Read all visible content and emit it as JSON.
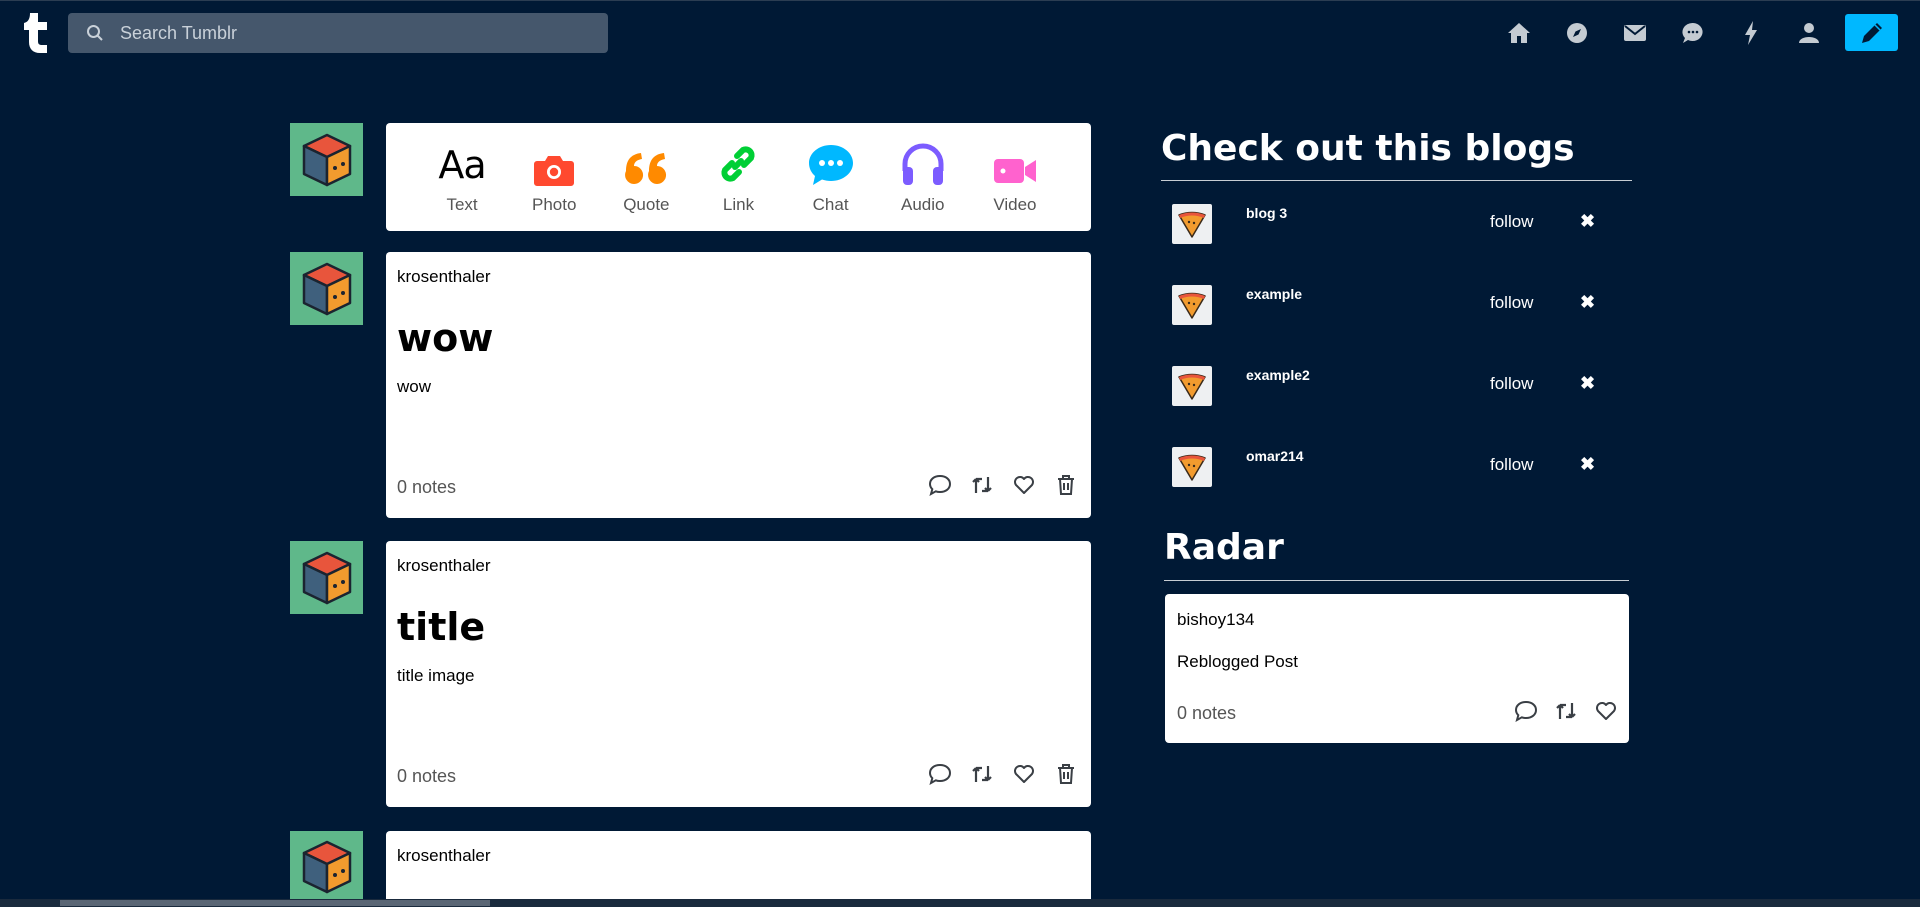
{
  "header": {
    "search_placeholder": "Search Tumblr",
    "nav": [
      "home-icon",
      "explore-icon",
      "inbox-icon",
      "messages-icon",
      "activity-icon",
      "account-icon"
    ],
    "compose": "pencil-icon"
  },
  "post_types": [
    {
      "label": "Text",
      "icon": "text-icon",
      "color": "#000000"
    },
    {
      "label": "Photo",
      "icon": "camera-icon",
      "color": "#ff492f"
    },
    {
      "label": "Quote",
      "icon": "quote-icon",
      "color": "#ff8a00"
    },
    {
      "label": "Link",
      "icon": "link-icon",
      "color": "#00cf35"
    },
    {
      "label": "Chat",
      "icon": "chat-icon",
      "color": "#00b8ff"
    },
    {
      "label": "Audio",
      "icon": "headphones-icon",
      "color": "#7c5cff"
    },
    {
      "label": "Video",
      "icon": "video-icon",
      "color": "#ff62ce"
    }
  ],
  "aa_glyph": "Aa",
  "posts": [
    {
      "author": "krosenthaler",
      "title": "wow",
      "body": "wow",
      "notes": "0 notes"
    },
    {
      "author": "krosenthaler",
      "title": "title",
      "body": "title image",
      "notes": "0 notes"
    },
    {
      "author": "krosenthaler"
    }
  ],
  "sidebar": {
    "heading": "Check out this blogs",
    "blogs": [
      {
        "name": "blog 3",
        "follow": "follow",
        "dismiss": "✖"
      },
      {
        "name": "example",
        "follow": "follow",
        "dismiss": "✖"
      },
      {
        "name": "example2",
        "follow": "follow",
        "dismiss": "✖"
      },
      {
        "name": "omar214",
        "follow": "follow",
        "dismiss": "✖"
      }
    ],
    "radar_heading": "Radar",
    "radar_post": {
      "author": "bishoy134",
      "text": "Reblogged Post",
      "notes": "0 notes"
    }
  },
  "colors": {
    "background": "#001935",
    "accent": "#00b8ff",
    "search_bg": "#45576c"
  }
}
